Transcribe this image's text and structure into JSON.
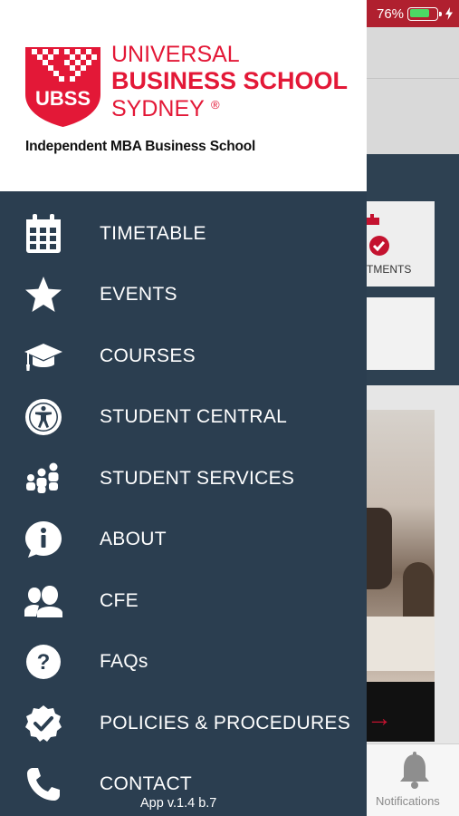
{
  "status_bar": {
    "battery_percent": "76%",
    "battery_level": 0.76
  },
  "brand": {
    "logo_badge": "UBSS",
    "logo_line1": "UNIVERSAL",
    "logo_line2": "BUSINESS SCHOOL",
    "logo_line3": "SYDNEY",
    "logo_mark": "®",
    "tagline": "Independent MBA Business School",
    "accent_color": "#e31837"
  },
  "menu": {
    "items": [
      {
        "label": "TIMETABLE",
        "icon": "calendar-icon"
      },
      {
        "label": "EVENTS",
        "icon": "star-icon"
      },
      {
        "label": "COURSES",
        "icon": "graduation-cap-icon"
      },
      {
        "label": "STUDENT CENTRAL",
        "icon": "accessibility-icon"
      },
      {
        "label": "STUDENT SERVICES",
        "icon": "users-icon"
      },
      {
        "label": "ABOUT",
        "icon": "info-bubble-icon"
      },
      {
        "label": "CFE",
        "icon": "user-group-icon"
      },
      {
        "label": "FAQs",
        "icon": "question-icon"
      },
      {
        "label": "POLICIES & PROCEDURES",
        "icon": "badge-check-icon"
      },
      {
        "label": "CONTACT",
        "icon": "phone-icon"
      }
    ]
  },
  "version": "App v.1.4 b.7",
  "background_app": {
    "card_label": "TMENTS",
    "tab_notifications": "Notifications"
  },
  "colors": {
    "drawer_bg": "#2b3e50",
    "header_bg": "#ffffff",
    "status_bar_bg": "#b0202f"
  }
}
